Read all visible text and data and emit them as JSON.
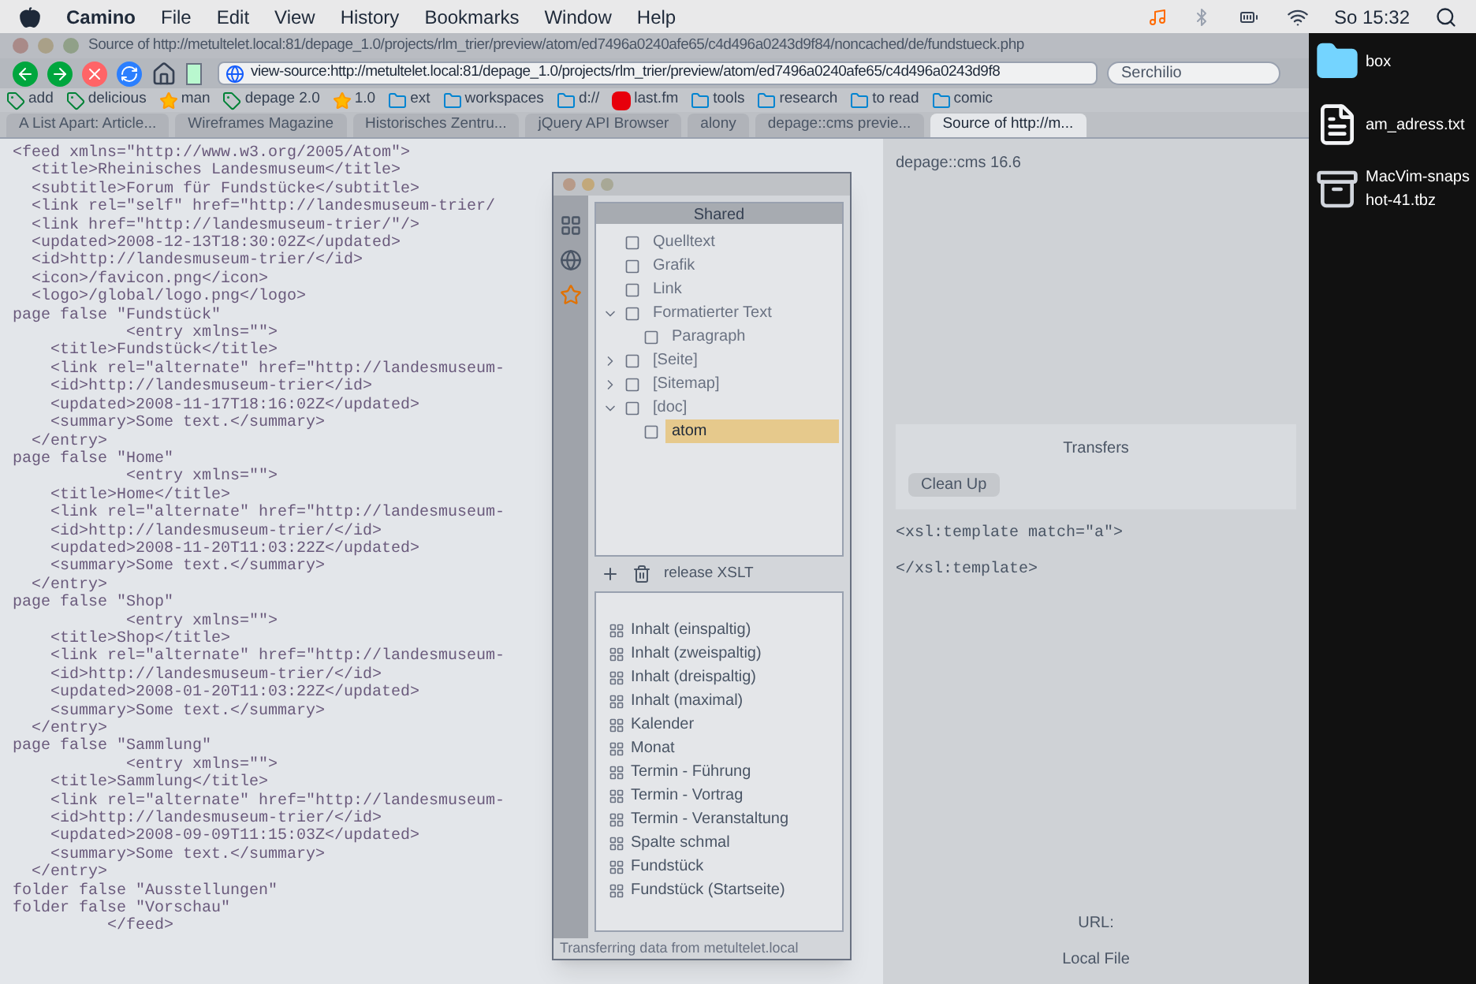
{
  "menu_bar": {
    "app": "Camino",
    "items": [
      "File",
      "Edit",
      "View",
      "History",
      "Bookmarks",
      "Window",
      "Help"
    ],
    "clock": "So 15:32"
  },
  "window": {
    "title": "Source of http://metultelet.local:81/depage_1.0/projects/rlm_trier/preview/atom/ed7496a0240afe65/c4d496a0243d9f84/noncached/de/fundstueck.php"
  },
  "address_bar": {
    "value": "view-source:http://metultelet.local:81/depage_1.0/projects/rlm_trier/preview/atom/ed7496a0240afe65/c4d496a0243d9f8"
  },
  "search": {
    "placeholder": "Serchilio"
  },
  "bookmarks": [
    {
      "label": "add",
      "kind": "tag"
    },
    {
      "label": "delicious",
      "kind": "tag"
    },
    {
      "label": "man",
      "kind": "star"
    },
    {
      "label": "depage 2.0",
      "kind": "tag"
    },
    {
      "label": "1.0",
      "kind": "star"
    },
    {
      "label": "ext",
      "kind": "folder"
    },
    {
      "label": "workspaces",
      "kind": "folder"
    },
    {
      "label": "d://",
      "kind": "folder"
    },
    {
      "label": "last.fm",
      "kind": "lastfm"
    },
    {
      "label": "tools",
      "kind": "folder"
    },
    {
      "label": "research",
      "kind": "folder"
    },
    {
      "label": "to read",
      "kind": "folder"
    },
    {
      "label": "comic",
      "kind": "folder"
    }
  ],
  "tabs": [
    {
      "label": "A List Apart: Article...",
      "selected": false
    },
    {
      "label": "Wireframes Magazine",
      "selected": false
    },
    {
      "label": "Historisches Zentru...",
      "selected": false
    },
    {
      "label": "jQuery API Browser",
      "selected": false
    },
    {
      "label": "alony",
      "selected": false
    },
    {
      "label": "depage::cms previe...",
      "selected": false
    },
    {
      "label": "Source of http://m...",
      "selected": true
    }
  ],
  "source_lines": [
    "<feed xmlns=\"http://www.w3.org/2005/Atom\">",
    "  <title>Rheinisches Landesmuseum</title>",
    "  <subtitle>Forum für Fundstücke</subtitle>",
    "  <link rel=\"self\" href=\"http://landesmuseum-trier/",
    "  <link href=\"http://landesmuseum-trier/\"/>",
    "  <updated>2008-12-13T18:30:02Z</updated>",
    "  <id>http://landesmuseum-trier/</id>",
    "  <icon>/favicon.png</icon>",
    "  <logo>/global/logo.png</logo>",
    "page false \"Fundstück\"",
    "            <entry xmlns=\"\">",
    "    <title>Fundstück</title>",
    "    <link rel=\"alternate\" href=\"http://landesmuseum-",
    "    <id>http://landesmuseum-trier</id>",
    "    <updated>2008-11-17T18:16:02Z</updated>",
    "    <summary>Some text.</summary>",
    "  </entry>",
    "page false \"Home\"",
    "            <entry xmlns=\"\">",
    "    <title>Home</title>",
    "    <link rel=\"alternate\" href=\"http://landesmuseum-",
    "    <id>http://landesmuseum-trier/</id>",
    "    <updated>2008-11-20T11:03:22Z</updated>",
    "    <summary>Some text.</summary>",
    "  </entry>",
    "page false \"Shop\"",
    "            <entry xmlns=\"\">",
    "    <title>Shop</title>",
    "    <link rel=\"alternate\" href=\"http://landesmuseum-",
    "    <id>http://landesmuseum-trier/</id>",
    "    <updated>2008-01-20T11:03:22Z</updated>",
    "    <summary>Some text.</summary>",
    "  </entry>",
    "page false \"Sammlung\"",
    "            <entry xmlns=\"\">",
    "    <title>Sammlung</title>",
    "    <link rel=\"alternate\" href=\"http://landesmuseum-",
    "    <id>http://landesmuseum-trier/</id>",
    "    <updated>2008-09-09T11:15:03Z</updated>",
    "    <summary>Some text.</summary>",
    "  </entry>",
    "folder false \"Ausstellungen\"",
    "folder false \"Vorschau\"",
    "          </feed>"
  ],
  "palette": {
    "tab": "Shared",
    "tree": [
      {
        "label": "Quelltext",
        "selected": false
      },
      {
        "label": "Grafik",
        "selected": false
      },
      {
        "label": "Link",
        "selected": false
      },
      {
        "label": "Formatierter Text",
        "expanded": true,
        "selected": false,
        "children": [
          {
            "label": "Paragraph",
            "selected": false
          }
        ]
      },
      {
        "label": "[Seite]",
        "expanded": false,
        "selected": false
      },
      {
        "label": "[Sitemap]",
        "expanded": false,
        "selected": false
      },
      {
        "label": "[doc]",
        "expanded": true,
        "selected": false,
        "children": [
          {
            "label": "atom",
            "selected": true
          }
        ]
      }
    ],
    "tree_footer": "release XSLT",
    "templates": [
      "Inhalt (einspaltig)",
      "Inhalt (zweispaltig)",
      "Inhalt (dreispaltig)",
      "Inhalt (maximal)",
      "Kalender",
      "Monat",
      "Termin - Führung",
      "Termin - Vortrag",
      "Termin - Veranstaltung",
      "Spalte schmal",
      "Fundstück",
      "Fundstück (Startseite)"
    ],
    "status": "Transferring data from metultelet.local"
  },
  "right_pane": {
    "title": "depage::cms 16.6",
    "lines": [
      "<xsl:template match=\"a\">",
      "</xsl:template>"
    ],
    "transfers_title": "Transfers",
    "clean_up": "Clean Up",
    "url_label": "URL:",
    "local_file_label": "Local File"
  },
  "desktop_icons": [
    {
      "label": "box",
      "kind": "folder"
    },
    {
      "label": "am_adress.txt",
      "kind": "file"
    },
    {
      "label": "MacVim-snapshot-41.tbz",
      "kind": "archive"
    }
  ]
}
